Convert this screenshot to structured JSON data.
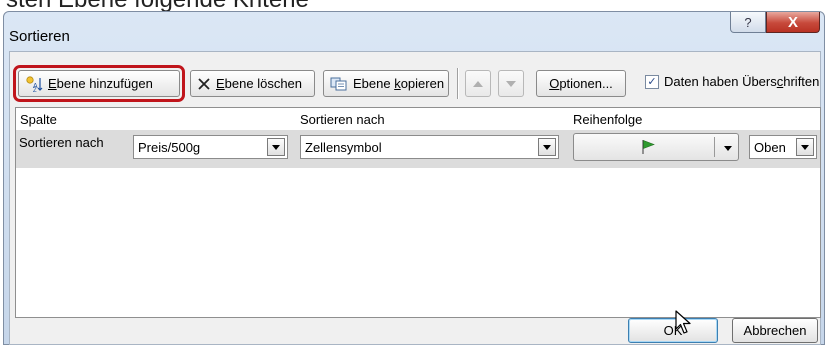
{
  "caption": {
    "text": "sten Ebene folgende Kriterie"
  },
  "window": {
    "title": "Sortieren",
    "help_glyph": "?",
    "close_glyph": "X"
  },
  "toolbar": {
    "add_level_pre": "",
    "add_level_ul": "E",
    "add_level_post": "bene hinzufügen",
    "delete_level_pre": "E",
    "delete_level_post": "bene löschen",
    "copy_level_pre": "Ebene ",
    "copy_level_ul": "k",
    "copy_level_post": "opieren",
    "options_ul": "O",
    "options_post": "ptionen...",
    "headers_checkbox_pre": "Daten haben Übers",
    "headers_checkbox_ul": "c",
    "headers_checkbox_post": "hriften",
    "headers_checked": true
  },
  "grid": {
    "headers": {
      "column": "Spalte",
      "sort_on": "Sortieren nach",
      "order": "Reihenfolge"
    },
    "rows": [
      {
        "label": "Sortieren nach",
        "column_value": "Preis/500g",
        "sort_on_value": "Zellensymbol",
        "order_icon": "green-flag-icon",
        "position_value": "Oben"
      }
    ]
  },
  "footer": {
    "ok_label": "OK",
    "cancel_label": "Abbrechen"
  },
  "colors": {
    "highlight": "#c0151b",
    "close_button": "#c7493b",
    "flag": "#2e9a2e"
  }
}
